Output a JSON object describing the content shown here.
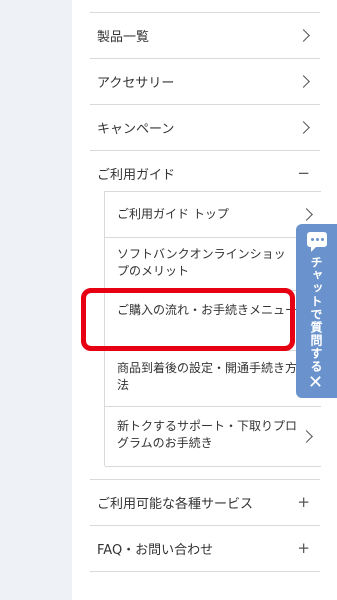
{
  "menu": {
    "items": [
      {
        "label": "製品一覧"
      },
      {
        "label": "アクセサリー"
      },
      {
        "label": "キャンペーン"
      },
      {
        "label": "ご利用ガイド",
        "toggle": "−"
      },
      {
        "label": "ご利用可能な各種サービス",
        "toggle": "+"
      },
      {
        "label": "FAQ・お問い合わせ",
        "toggle": "+"
      }
    ],
    "guide_sub": [
      {
        "label": "ご利用ガイド トップ"
      },
      {
        "label": "ソフトバンクオンラインショップのメリット"
      },
      {
        "label": "ご購入の流れ・お手続きメニュー"
      },
      {
        "label": "商品到着後の設定・開通手続き方法"
      },
      {
        "label": "新トクするサポート・下取りプログラムのお手続き"
      }
    ]
  },
  "chat": {
    "label": "チャットで質問する",
    "close": "✕"
  },
  "colors": {
    "highlight": "#e60012",
    "chat_bg": "#6a93cd"
  }
}
